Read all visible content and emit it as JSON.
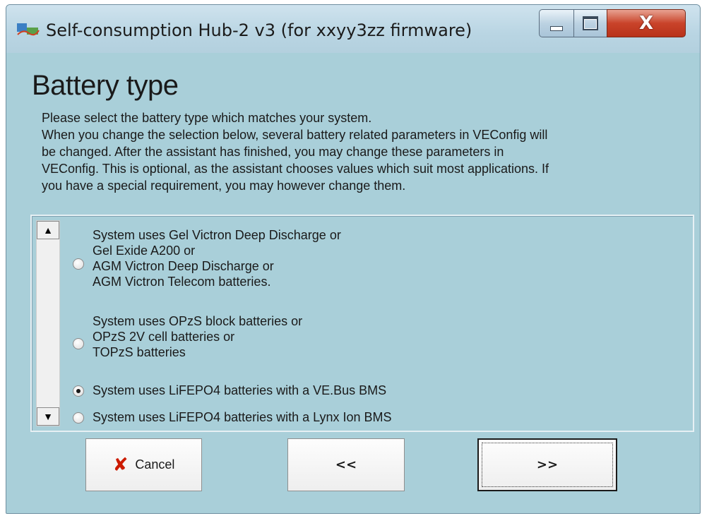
{
  "window": {
    "title": "Self-consumption Hub-2 v3 (for xxyy3zz firmware)",
    "icon": "app-logo-icon",
    "controls": {
      "minimize": "minimize-icon",
      "maximize": "maximize-icon",
      "close": "X"
    }
  },
  "page": {
    "heading": "Battery type",
    "description": [
      "Please select the battery type which matches your system.",
      "When you change the selection below, several battery related parameters in VEConfig will",
      "be changed. After the assistant has finished, you may change these parameters in",
      "VEConfig. This is optional, as the assistant chooses values which suit most applications. If",
      "you have a special requirement, you may however change them."
    ]
  },
  "options": [
    {
      "lines": [
        "System uses Gel Victron Deep Discharge or",
        "Gel Exide A200 or",
        "AGM Victron Deep Discharge or",
        "AGM Victron Telecom batteries."
      ],
      "selected": false
    },
    {
      "lines": [
        "System uses OPzS block batteries or",
        "OPzS 2V cell batteries or",
        "TOPzS batteries"
      ],
      "selected": false
    },
    {
      "lines": [
        "System uses LiFEPO4 batteries with a VE.Bus BMS"
      ],
      "selected": true
    },
    {
      "lines": [
        "System uses LiFEPO4 batteries with a Lynx Ion BMS"
      ],
      "selected": false
    }
  ],
  "buttons": {
    "cancel": "Cancel",
    "back": "<<",
    "next": ">>"
  },
  "colors": {
    "window_bg": "#a9cfd9",
    "close_button": "#c9432a",
    "cancel_icon": "#cc1b00"
  }
}
